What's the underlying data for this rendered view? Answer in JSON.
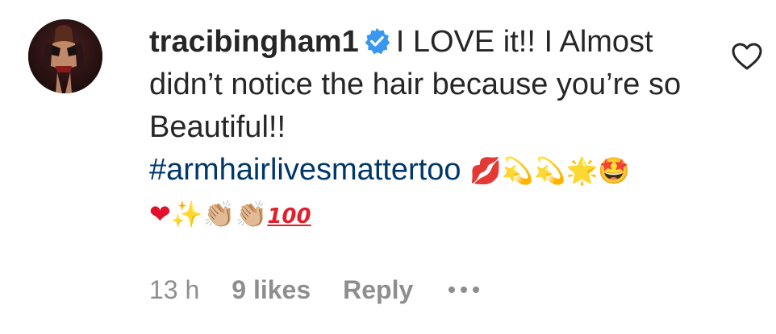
{
  "comment": {
    "username": "tracibingham1",
    "verified": true,
    "text": "I LOVE it!! I Almost didn’t notice the hair because you’re so Beautiful!!",
    "hashtag": "#armhairlivesmattertoo",
    "emojis_line1": {
      "kiss": "💋",
      "dizzy": "💫💫",
      "star": "🌟",
      "starstruck": "🤩"
    },
    "emojis_line2": {
      "heart": "❤",
      "sparkles": "✨",
      "clap": "👏🏼👏🏼",
      "hundred": "100"
    },
    "timestamp": "13 h",
    "likes_label": "9 likes",
    "reply_label": "Reply"
  },
  "icons": {
    "avatar": "avatar-photo",
    "verified": "verified-badge-icon",
    "like": "heart-outline-icon",
    "more": "more-options-icon"
  },
  "colors": {
    "text": "#262626",
    "secondary": "#8e8e8e",
    "hashtag": "#00376b",
    "verified": "#3897f0"
  }
}
